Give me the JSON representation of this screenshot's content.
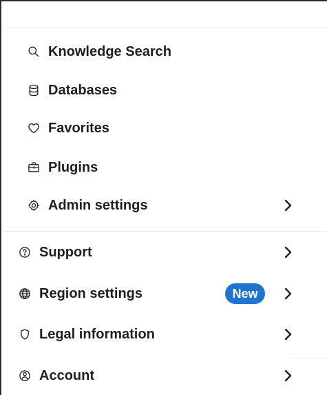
{
  "menu": {
    "top_group": [
      {
        "label": "Knowledge Search",
        "icon": "search-icon",
        "has_chevron": false
      },
      {
        "label": "Databases",
        "icon": "database-icon",
        "has_chevron": false
      },
      {
        "label": "Favorites",
        "icon": "heart-icon",
        "has_chevron": false
      },
      {
        "label": "Plugins",
        "icon": "briefcase-icon",
        "has_chevron": false
      },
      {
        "label": "Admin settings",
        "icon": "gear-icon",
        "has_chevron": true
      }
    ],
    "bottom_group": [
      {
        "label": "Support",
        "icon": "help-circle-icon",
        "has_chevron": true
      },
      {
        "label": "Region settings",
        "icon": "globe-icon",
        "has_chevron": true,
        "badge": "New"
      },
      {
        "label": "Legal information",
        "icon": "shield-icon",
        "has_chevron": true
      },
      {
        "label": "Account",
        "icon": "user-circle-icon",
        "has_chevron": true
      }
    ]
  },
  "colors": {
    "badge_background": "#1f74d2",
    "badge_text": "#ffffff",
    "text": "#1f1f1f",
    "divider": "#e9e9e9",
    "frame_border": "#2b2b2b"
  }
}
